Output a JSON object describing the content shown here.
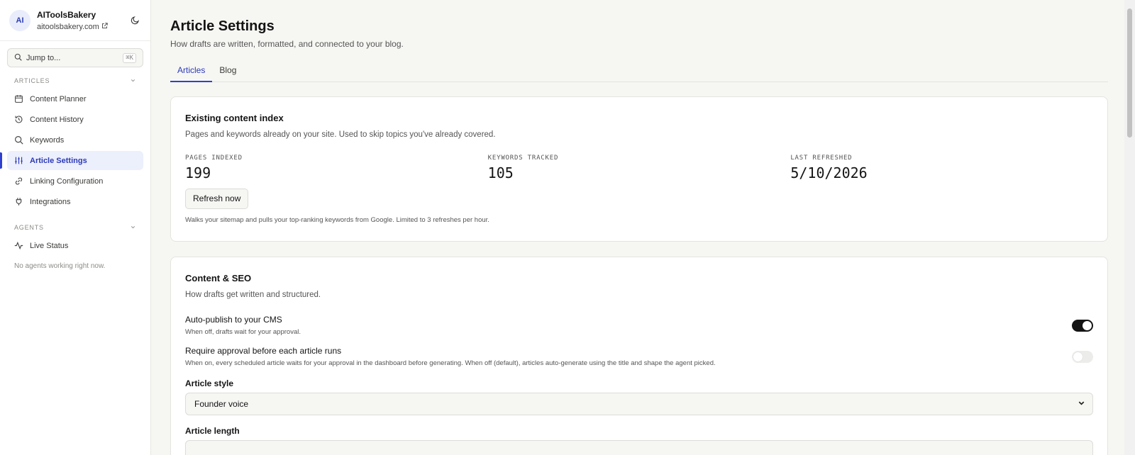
{
  "workspace": {
    "initials": "AI",
    "name": "AIToolsBakery",
    "domain": "aitoolsbakery.com"
  },
  "search": {
    "placeholder": "Jump to...",
    "shortcut": "⌘K"
  },
  "sidebar": {
    "articles_label": "ARTICLES",
    "items": [
      {
        "label": "Content Planner",
        "icon": "calendar-icon"
      },
      {
        "label": "Content History",
        "icon": "history-icon"
      },
      {
        "label": "Keywords",
        "icon": "search-icon"
      },
      {
        "label": "Article Settings",
        "icon": "sliders-icon"
      },
      {
        "label": "Linking Configuration",
        "icon": "link-icon"
      },
      {
        "label": "Integrations",
        "icon": "plug-icon"
      }
    ],
    "agents_label": "AGENTS",
    "agent_items": [
      {
        "label": "Live Status",
        "icon": "activity-icon"
      }
    ],
    "agents_empty": "No agents working right now."
  },
  "page": {
    "title": "Article Settings",
    "subtitle": "How drafts are written, formatted, and connected to your blog.",
    "tabs": [
      {
        "label": "Articles"
      },
      {
        "label": "Blog"
      }
    ]
  },
  "index_card": {
    "title": "Existing content index",
    "description": "Pages and keywords already on your site. Used to skip topics you've already covered.",
    "stats": [
      {
        "label": "PAGES INDEXED",
        "value": "199"
      },
      {
        "label": "KEYWORDS TRACKED",
        "value": "105"
      },
      {
        "label": "LAST REFRESHED",
        "value": "5/10/2026"
      }
    ],
    "refresh_label": "Refresh now",
    "hint": "Walks your sitemap and pulls your top-ranking keywords from Google. Limited to 3 refreshes per hour."
  },
  "seo_card": {
    "title": "Content & SEO",
    "description": "How drafts get written and structured.",
    "auto_publish": {
      "title": "Auto-publish to your CMS",
      "desc": "When off, drafts wait for your approval.",
      "on": true
    },
    "require_approval": {
      "title": "Require approval before each article runs",
      "desc": "When on, every scheduled article waits for your approval in the dashboard before generating. When off (default), articles auto-generate using the title and shape the agent picked.",
      "on": false
    },
    "article_style": {
      "label": "Article style",
      "value": "Founder voice"
    },
    "article_length": {
      "label": "Article length"
    }
  },
  "colors": {
    "accent": "#2f3fd0",
    "active_bg": "#eceffc",
    "background": "#f6f6f3"
  }
}
